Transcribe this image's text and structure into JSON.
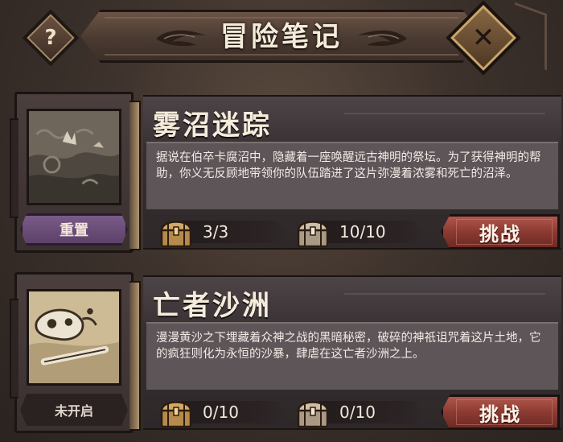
{
  "header": {
    "title": "冒险笔记",
    "help_symbol": "?",
    "close_symbol": "✕"
  },
  "cards": [
    {
      "title": "雾沼迷踪",
      "description": "据说在伯卒卡腐沼中，隐藏着一座唤醒远古神明的祭坛。为了获得神明的帮助，你义无反顾地带领你的队伍踏进了这片弥漫着浓雾和死亡的沼泽。",
      "status_label": "重置",
      "chest_a_count": "3/3",
      "chest_b_count": "10/10",
      "button_label": "挑战"
    },
    {
      "title": "亡者沙洲",
      "description": "漫漫黄沙之下埋藏着众神之战的黑暗秘密，破碎的神祇诅咒着这片土地，它的疯狂则化为永恒的沙暴，肆虐在这亡者沙洲之上。",
      "status_label": "未开启",
      "chest_a_count": "0/10",
      "chest_b_count": "0/10",
      "button_label": "挑战"
    }
  ],
  "icons": {
    "help": "question-mark-icon",
    "close": "close-x-icon",
    "chest": "treasure-chest-icon",
    "ornament": "wing-ornament-icon"
  },
  "colors": {
    "reset_purple": "#6c4f7a",
    "challenge_red": "#8b3a32",
    "panel_dark": "#2e2829"
  }
}
